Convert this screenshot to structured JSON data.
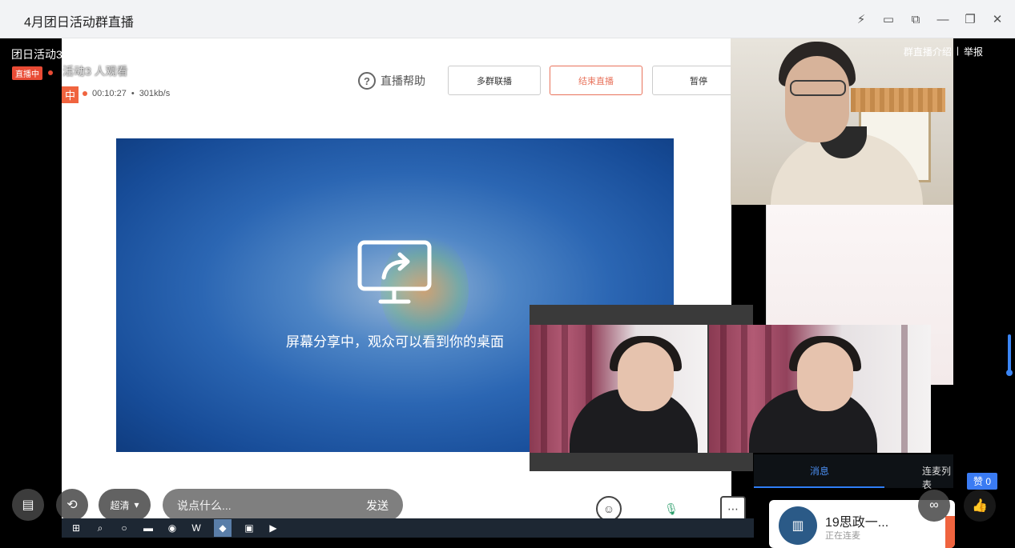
{
  "window": {
    "title": "4月团日活动群直播",
    "controls": [
      "lightning-icon",
      "screen-cast-icon",
      "restore-icon",
      "minimize-icon",
      "maximize-icon",
      "close-icon"
    ]
  },
  "overlay": {
    "room_name": "团日活动3",
    "live_badge": "直播中",
    "viewers_text": "活动3  人观看",
    "intro_link": "群直播介绍",
    "separator": "|",
    "report_link": "举报"
  },
  "streamer_panel": {
    "help_label": "直播帮助",
    "multi_group_label": "多群联播",
    "end_label": "结束直播",
    "pause_label": "暂停",
    "live_tag": "中",
    "duration": "00:10:27",
    "bitrate": "301kb/s",
    "share_message": "屏幕分享中，观众可以看到你的桌面"
  },
  "right_panel": {
    "tabs": [
      {
        "label": "消息",
        "active": true
      },
      {
        "label": "连麦列表",
        "active": false
      }
    ],
    "chat_card": {
      "name": "19思政一...",
      "status": "正在连麦"
    },
    "like_count": "赞 0"
  },
  "toolbar": {
    "quality_label": "超清",
    "input_placeholder": "说点什么...",
    "send_label": "发送"
  },
  "colors": {
    "live_red": "#e94b35",
    "accent_blue": "#2f7df6",
    "end_orange": "#e8735c"
  }
}
